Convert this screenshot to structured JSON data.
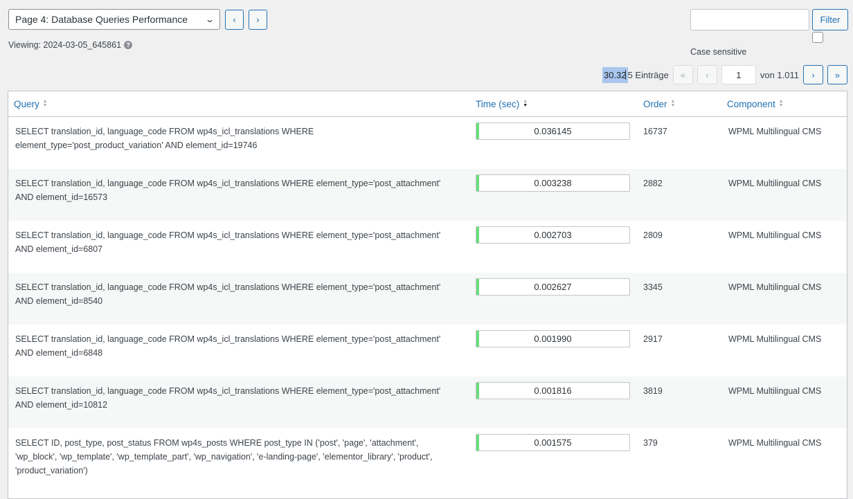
{
  "toolbar": {
    "page_select_value": "Page 4: Database Queries Performance",
    "prev_label": "‹",
    "next_label": "›",
    "viewing_text": "Viewing: 2024-03-05_645861",
    "filter_label": "Filter",
    "filter_value": "",
    "case_sensitive_label": "Case sensitive"
  },
  "pagination": {
    "count_highlight": "30.32",
    "count_rest": "5 Einträge",
    "first_label": "«",
    "prev_label": "‹",
    "current_page": "1",
    "of_pages": "von 1.011",
    "next_label": "›",
    "last_label": "»"
  },
  "table": {
    "headers": {
      "query": "Query",
      "time": "Time (sec)",
      "order": "Order",
      "component": "Component"
    },
    "rows": [
      {
        "query": "SELECT translation_id, language_code FROM wp4s_icl_translations WHERE element_type='post_product_variation' AND element_id=19746",
        "time": "0.036145",
        "time_fraction": 0.012,
        "order": "16737",
        "component": "WPML Multilingual CMS"
      },
      {
        "query": "SELECT translation_id, language_code FROM wp4s_icl_translations WHERE element_type='post_attachment' AND element_id=16573",
        "time": "0.003238",
        "time_fraction": 0.01,
        "order": "2882",
        "component": "WPML Multilingual CMS"
      },
      {
        "query": "SELECT translation_id, language_code FROM wp4s_icl_translations WHERE element_type='post_attachment' AND element_id=6807",
        "time": "0.002703",
        "time_fraction": 0.01,
        "order": "2809",
        "component": "WPML Multilingual CMS"
      },
      {
        "query": "SELECT translation_id, language_code FROM wp4s_icl_translations WHERE element_type='post_attachment' AND element_id=8540",
        "time": "0.002627",
        "time_fraction": 0.01,
        "order": "3345",
        "component": "WPML Multilingual CMS"
      },
      {
        "query": "SELECT translation_id, language_code FROM wp4s_icl_translations WHERE element_type='post_attachment' AND element_id=6848",
        "time": "0.001990",
        "time_fraction": 0.01,
        "order": "2917",
        "component": "WPML Multilingual CMS"
      },
      {
        "query": "SELECT translation_id, language_code FROM wp4s_icl_translations WHERE element_type='post_attachment' AND element_id=10812",
        "time": "0.001816",
        "time_fraction": 0.01,
        "order": "3819",
        "component": "WPML Multilingual CMS"
      },
      {
        "query": "SELECT ID, post_type, post_status FROM wp4s_posts WHERE post_type IN ('post', 'page', 'attachment', 'wp_block', 'wp_template', 'wp_template_part', 'wp_navigation', 'e-landing-page', 'elementor_library', 'product', 'product_variation')",
        "time": "0.001575",
        "time_fraction": 0.01,
        "order": "379",
        "component": "WPML Multilingual CMS"
      }
    ]
  },
  "colors": {
    "accent": "#2271b1",
    "bar": "#68de7c",
    "background": "#f0f0f1"
  },
  "icons": {
    "help": "help-icon",
    "select": "chevron-down-icon",
    "sort": "sort-icon"
  }
}
